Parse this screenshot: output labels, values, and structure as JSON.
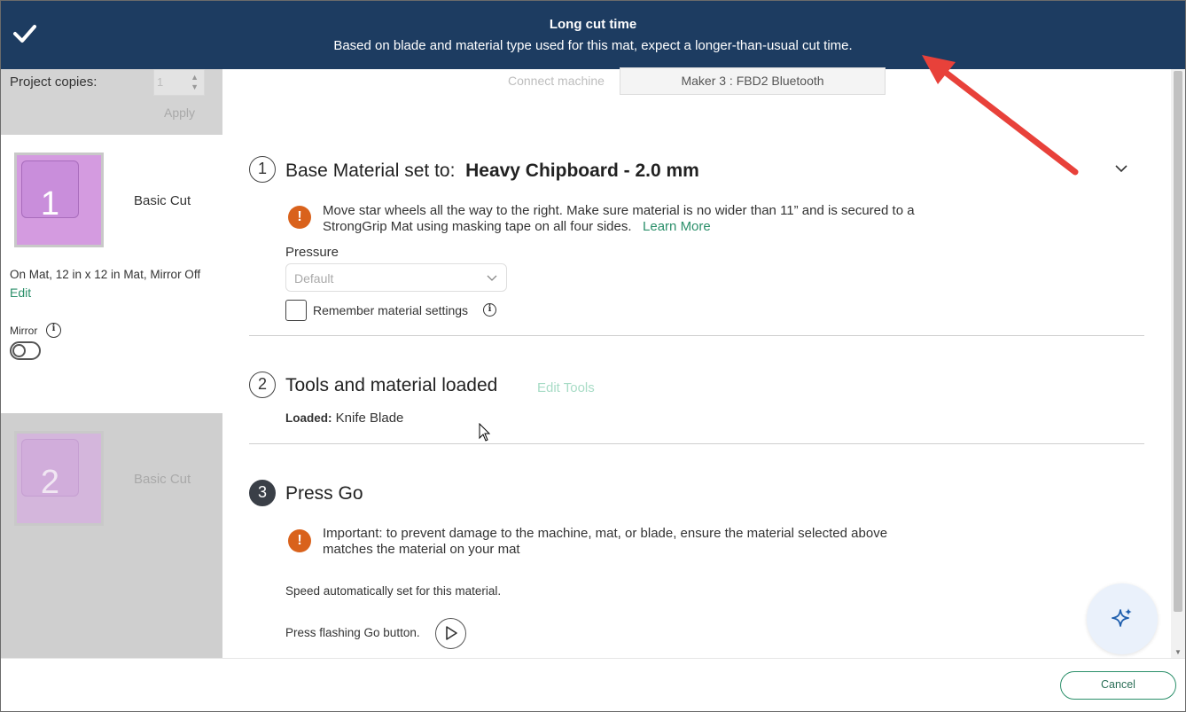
{
  "banner": {
    "title": "Long cut time",
    "message": "Based on blade and material type used for this mat, expect a longer-than-usual cut time."
  },
  "left_panel": {
    "copies_label": "Project copies:",
    "copies_value": "1",
    "apply_label": "Apply",
    "mats": [
      {
        "number": "1",
        "name": "Basic Cut"
      },
      {
        "number": "2",
        "name": "Basic Cut"
      }
    ],
    "mat_info": "On Mat, 12 in x 12 in Mat, Mirror Off",
    "edit_label": "Edit",
    "mirror_label": "Mirror",
    "mirror_on": false
  },
  "connect": {
    "label": "Connect machine",
    "machine": "Maker 3 : FBD2 Bluetooth"
  },
  "steps": {
    "step1": {
      "number": "1",
      "title_prefix": "Base Material set to:",
      "material": "Heavy Chipboard - 2.0 mm",
      "warning": "Move star wheels all the way to the right. Make sure material is no wider than 11” and is secured to a StrongGrip Mat using masking tape on all four sides.",
      "learn_more": "Learn More",
      "pressure_label": "Pressure",
      "pressure_value": "Default",
      "remember_label": "Remember material settings",
      "remember_checked": false
    },
    "step2": {
      "number": "2",
      "title": "Tools and material loaded",
      "edit_tools": "Edit Tools",
      "loaded_label": "Loaded:",
      "loaded_value": "Knife Blade"
    },
    "step3": {
      "number": "3",
      "title": "Press Go",
      "warning": "Important: to prevent damage to the machine, mat, or blade, ensure the material selected above matches the material on your mat",
      "speed_note": "Speed automatically set for this material.",
      "go_note": "Press flashing Go button."
    }
  },
  "footer": {
    "cancel_label": "Cancel"
  },
  "colors": {
    "banner_bg": "#1d3c61",
    "accent_green": "#2b8f6a",
    "warning_orange": "#d9621c",
    "annotation_arrow": "#e8413a"
  },
  "icons": [
    "check-icon",
    "up-arrow-icon",
    "down-arrow-icon",
    "info-icon",
    "chevron-down-icon",
    "warning-icon",
    "play-icon",
    "sparkle-icon"
  ]
}
